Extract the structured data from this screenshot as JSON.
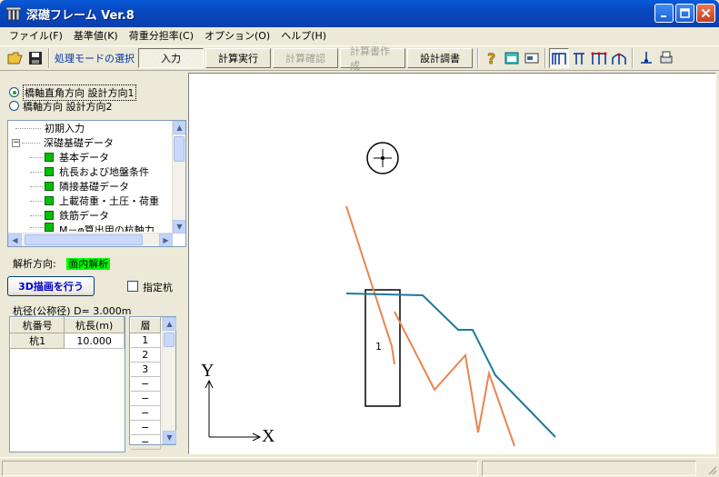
{
  "window": {
    "title": "深礎フレーム Ver.8"
  },
  "menu": [
    {
      "label": "ファイル(F)"
    },
    {
      "label": "基準値(K)"
    },
    {
      "label": "荷重分担率(C)"
    },
    {
      "label": "オプション(O)"
    },
    {
      "label": "ヘルプ(H)"
    }
  ],
  "toolbar": {
    "mode_label": "処理モードの選択",
    "buttons": [
      {
        "label": "入力",
        "state": "pressed"
      },
      {
        "label": "計算実行",
        "state": "normal"
      },
      {
        "label": "計算確認",
        "state": "disabled"
      },
      {
        "label": "計算書作成",
        "state": "disabled"
      },
      {
        "label": "設計調書",
        "state": "normal"
      }
    ]
  },
  "left": {
    "radio1": "橋軸直角方向 設計方向1",
    "radio2": "橋軸方向 設計方向2",
    "tree": {
      "root_item": "初期入力",
      "group": "深礎基礎データ",
      "children": [
        "基本データ",
        "杭長および地盤条件",
        "隣接基礎データ",
        "上載荷重・土圧・荷重",
        "鉄筋データ",
        "M－φ算出用の杭軸力"
      ]
    },
    "analysis_label": "解析方向:",
    "analysis_value": "面内解析",
    "draw3d_button": "3D描画を行う",
    "designated_pile": "指定杭",
    "pile_diameter": "杭径(公称径) D= 3.000m",
    "pile_table": {
      "headers": [
        "杭番号",
        "杭長(m)"
      ],
      "rows": [
        [
          "杭1",
          "10.000"
        ]
      ]
    },
    "layer_table": {
      "header": "層",
      "rows": [
        "1",
        "2",
        "3",
        "−",
        "−",
        "−",
        "−",
        "−"
      ]
    }
  },
  "canvas": {
    "pile_label": "1",
    "axis_y": "Y",
    "axis_x": "X"
  },
  "colors": {
    "orange_line": "#e8854f",
    "blue_line": "#1f7a9a",
    "accent": "#0033aa"
  }
}
